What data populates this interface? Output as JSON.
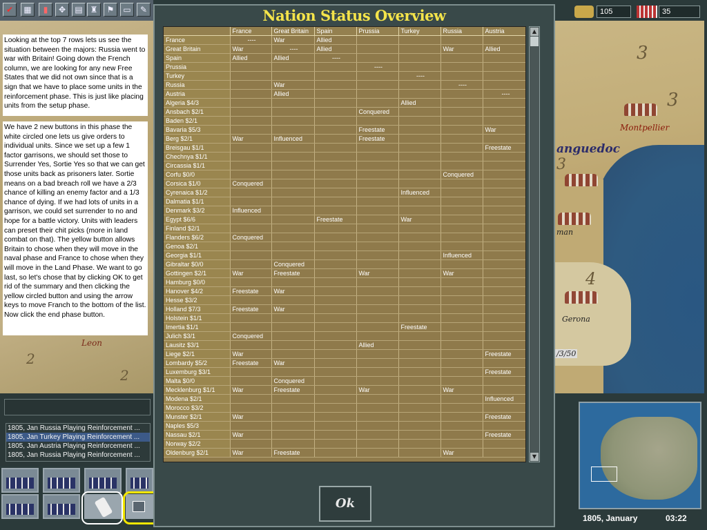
{
  "dialog": {
    "title": "Nation Status Overview",
    "ok_label": "Ok"
  },
  "table": {
    "columns": [
      "",
      "France",
      "Great Britain",
      "Spain",
      "Prussia",
      "Turkey",
      "Russia",
      "Austria"
    ],
    "rows": [
      [
        "France",
        "----",
        "War",
        "Allied",
        "",
        "",
        "",
        ""
      ],
      [
        "Great Britain",
        "War",
        "----",
        "Allied",
        "",
        "",
        "War",
        "Allied"
      ],
      [
        "Spain",
        "Allied",
        "Allied",
        "----",
        "",
        "",
        "",
        ""
      ],
      [
        "Prussia",
        "",
        "",
        "",
        "----",
        "",
        "",
        ""
      ],
      [
        "Turkey",
        "",
        "",
        "",
        "",
        "----",
        "",
        ""
      ],
      [
        "Russia",
        "",
        "War",
        "",
        "",
        "",
        "----",
        ""
      ],
      [
        "Austria",
        "",
        "Allied",
        "",
        "",
        "",
        "",
        "----"
      ],
      [
        "Algeria $4/3",
        "",
        "",
        "",
        "",
        "Allied",
        "",
        ""
      ],
      [
        "Ansbach $2/1",
        "",
        "",
        "",
        "Conquered",
        "",
        "",
        ""
      ],
      [
        "Baden $2/1",
        "",
        "",
        "",
        "",
        "",
        "",
        ""
      ],
      [
        "Bavaria $5/3",
        "",
        "",
        "",
        "Freestate",
        "",
        "",
        "War"
      ],
      [
        "Berg $2/1",
        "War",
        "Influenced",
        "",
        "Freestate",
        "",
        "",
        ""
      ],
      [
        "Breisgau $1/1",
        "",
        "",
        "",
        "",
        "",
        "",
        "Freestate"
      ],
      [
        "Chechnya $1/1",
        "",
        "",
        "",
        "",
        "",
        "",
        ""
      ],
      [
        "Circassia $1/1",
        "",
        "",
        "",
        "",
        "",
        "",
        ""
      ],
      [
        "Corfu $0/0",
        "",
        "",
        "",
        "",
        "",
        "Conquered",
        ""
      ],
      [
        "Corsica $1/0",
        "Conquered",
        "",
        "",
        "",
        "",
        "",
        ""
      ],
      [
        "Cyrenaica $1/2",
        "",
        "",
        "",
        "",
        "Influenced",
        "",
        ""
      ],
      [
        "Dalmatia $1/1",
        "",
        "",
        "",
        "",
        "",
        "",
        ""
      ],
      [
        "Denmark $3/2",
        "Influenced",
        "",
        "",
        "",
        "",
        "",
        ""
      ],
      [
        "Egypt $6/6",
        "",
        "",
        "Freestate",
        "",
        "War",
        "",
        ""
      ],
      [
        "Finland $2/1",
        "",
        "",
        "",
        "",
        "",
        "",
        ""
      ],
      [
        "Flanders $6/2",
        "Conquered",
        "",
        "",
        "",
        "",
        "",
        ""
      ],
      [
        "Genoa $2/1",
        "",
        "",
        "",
        "",
        "",
        "",
        ""
      ],
      [
        "Georgia $1/1",
        "",
        "",
        "",
        "",
        "",
        "Influenced",
        ""
      ],
      [
        "Gibraltar $0/0",
        "",
        "Conquered",
        "",
        "",
        "",
        "",
        ""
      ],
      [
        "Gottingen $2/1",
        "War",
        "Freestate",
        "",
        "War",
        "",
        "War",
        ""
      ],
      [
        "Hamburg $0/0",
        "",
        "",
        "",
        "",
        "",
        "",
        ""
      ],
      [
        "Hanover $4/2",
        "Freestate",
        "War",
        "",
        "",
        "",
        "",
        ""
      ],
      [
        "Hesse $3/2",
        "",
        "",
        "",
        "",
        "",
        "",
        ""
      ],
      [
        "Holland $7/3",
        "Freestate",
        "War",
        "",
        "",
        "",
        "",
        ""
      ],
      [
        "Holstein $1/1",
        "",
        "",
        "",
        "",
        "",
        "",
        ""
      ],
      [
        "Imertia $1/1",
        "",
        "",
        "",
        "",
        "Freestate",
        "",
        ""
      ],
      [
        "Julich $3/1",
        "Conquered",
        "",
        "",
        "",
        "",
        "",
        ""
      ],
      [
        "Lausitz $3/1",
        "",
        "",
        "",
        "Allied",
        "",
        "",
        ""
      ],
      [
        "Liege $2/1",
        "War",
        "",
        "",
        "",
        "",
        "",
        "Freestate"
      ],
      [
        "Lombardy $5/2",
        "Freestate",
        "War",
        "",
        "",
        "",
        "",
        ""
      ],
      [
        "Luxemburg $3/1",
        "",
        "",
        "",
        "",
        "",
        "",
        "Freestate"
      ],
      [
        "Malta $0/0",
        "",
        "Conquered",
        "",
        "",
        "",
        "",
        ""
      ],
      [
        "Mecklenburg $1/1",
        "War",
        "Freestate",
        "",
        "War",
        "",
        "War",
        ""
      ],
      [
        "Modena $2/1",
        "",
        "",
        "",
        "",
        "",
        "",
        "Influenced"
      ],
      [
        "Morocco $3/2",
        "",
        "",
        "",
        "",
        "",
        "",
        ""
      ],
      [
        "Munster $2/1",
        "War",
        "",
        "",
        "",
        "",
        "",
        "Freestate"
      ],
      [
        "Naples $5/3",
        "",
        "",
        "",
        "",
        "",
        "",
        ""
      ],
      [
        "Nassau $2/1",
        "War",
        "",
        "",
        "",
        "",
        "",
        "Freestate"
      ],
      [
        "Norway $2/2",
        "",
        "",
        "",
        "",
        "",
        "",
        ""
      ],
      [
        "Oldenburg $2/1",
        "War",
        "Freestate",
        "",
        "",
        "",
        "War",
        ""
      ]
    ]
  },
  "left_panel": {
    "note1": "Looking at the top 7 rows lets us see the situation between the majors: Russia went to war with Britain! Going down the French column, we are looking for any new Free States that we did not own since that is a sign that we have to place some units in the reinforcement phase. This is just like placing units from the setup phase.",
    "note2": "We have 2 new buttons in this phase the white circled one lets us give orders to individual units. Since we set up a few 1 factor garrisons, we should set those to Surrender Yes, Sortie Yes so that we can get those units back as prisoners later. Sortie means on a bad breach roll we have a 2/3 chance of killing an enemy factor and a 1/3 chance of dying. If we had lots of units in a garrison, we could set surrender to no and hope for a battle victory. Units with leaders can preset their chit picks (more in land combat on that). The yellow button allows Britain to chose when they will move in the naval phase and France to chose when they will move in the Land Phase. We want to go last, so let's chose that by clicking OK to get rid of the summary and then clicking the yellow circled button and using the arrow keys to move Franch to the bottom of the list. Now click the end phase button.",
    "map_label": "Leon",
    "map_numbers": [
      "2",
      "2"
    ]
  },
  "log": [
    "1805, Jan Russia Playing Reinforcement ...",
    "1805, Jan Turkey Playing Reinforcement ...",
    "1805, Jan Austria Playing Reinforcement ...",
    "1805, Jan Russia Playing Reinforcement ..."
  ],
  "resources": {
    "money": "105",
    "manpower": "35"
  },
  "right_map": {
    "region": "anguedoc",
    "cities": [
      "Montpellier",
      "man",
      "Gerona"
    ],
    "numbers": [
      "3",
      "3",
      "3",
      "4"
    ],
    "counter": "/3/50"
  },
  "status": {
    "date": "1805, January",
    "time": "03:22"
  },
  "colors": {
    "title": "#f4e44a",
    "table_bg": "#8f7a4b",
    "highlight_white": "#ffffff",
    "highlight_yellow": "#f4e600"
  },
  "icons": [
    "checkmark-icon",
    "map-icon",
    "chart-icon",
    "diplomacy-icon",
    "economy-icon",
    "fortress-icon",
    "flag-icon",
    "document-icon",
    "tools-icon",
    "coins-icon",
    "soldiers-icon",
    "order-scroll-icon",
    "move-order-icon"
  ]
}
